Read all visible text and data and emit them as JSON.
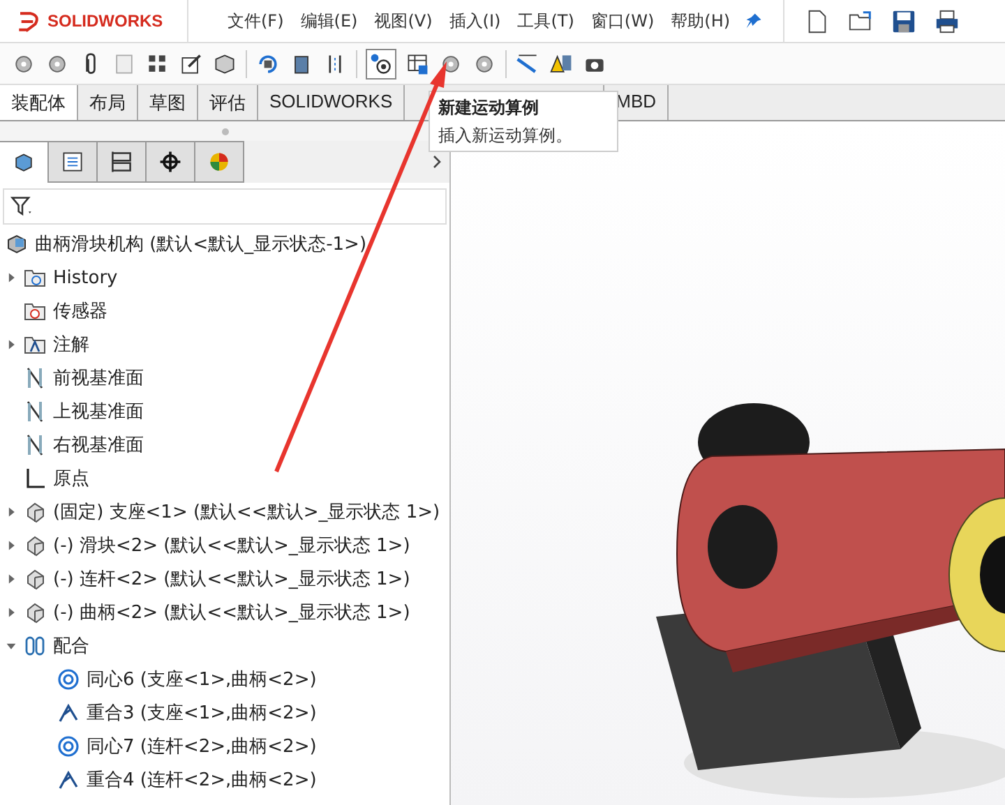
{
  "title_bar": {
    "logo": "SOLIDWORKS",
    "menus": [
      "文件(F)",
      "编辑(E)",
      "视图(V)",
      "插入(I)",
      "工具(T)",
      "窗口(W)",
      "帮助(H)"
    ]
  },
  "command_tabs": [
    {
      "label": "装配体",
      "selected": true
    },
    {
      "label": "布局",
      "selected": false
    },
    {
      "label": "草图",
      "selected": false
    },
    {
      "label": "评估",
      "selected": false
    },
    {
      "label": "SOLIDWORKS",
      "selected": false
    },
    {
      "label": "MBD",
      "selected": false
    }
  ],
  "tooltip": {
    "title": "新建运动算例",
    "text": "插入新运动算例。"
  },
  "panel_tabs": [
    {
      "kind": "feature-tree",
      "selected": true
    },
    {
      "kind": "property",
      "selected": false
    },
    {
      "kind": "config",
      "selected": false
    },
    {
      "kind": "dimxpert",
      "selected": false
    },
    {
      "kind": "display",
      "selected": false
    }
  ],
  "tree": {
    "root": "曲柄滑块机构 (默认<默认_显示状态-1>)",
    "items": [
      {
        "kind": "history",
        "label": "History",
        "expanded": false
      },
      {
        "kind": "sensor",
        "label": "传感器"
      },
      {
        "kind": "annotation",
        "label": "注解",
        "expanded": false
      },
      {
        "kind": "plane",
        "label": "前视基准面"
      },
      {
        "kind": "plane",
        "label": "上视基准面"
      },
      {
        "kind": "plane",
        "label": "右视基准面"
      },
      {
        "kind": "origin",
        "label": "原点"
      },
      {
        "kind": "part",
        "label": "(固定) 支座<1> (默认<<默认>_显示状态 1>)",
        "expanded": false
      },
      {
        "kind": "part",
        "label": "(-) 滑块<2> (默认<<默认>_显示状态 1>)",
        "expanded": false
      },
      {
        "kind": "part",
        "label": "(-) 连杆<2> (默认<<默认>_显示状态 1>)",
        "expanded": false
      },
      {
        "kind": "part",
        "label": "(-) 曲柄<2> (默认<<默认>_显示状态 1>)",
        "expanded": false
      },
      {
        "kind": "mates",
        "label": "配合",
        "expanded": true,
        "children": [
          {
            "kind": "concentric",
            "label": "同心6 (支座<1>,曲柄<2>)"
          },
          {
            "kind": "coincident",
            "label": "重合3 (支座<1>,曲柄<2>)"
          },
          {
            "kind": "concentric",
            "label": "同心7 (连杆<2>,曲柄<2>)"
          },
          {
            "kind": "coincident",
            "label": "重合4 (连杆<2>,曲柄<2>)"
          }
        ]
      }
    ]
  }
}
